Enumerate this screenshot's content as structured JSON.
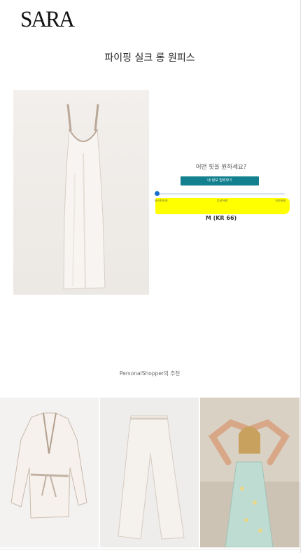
{
  "brand": {
    "logo_text": "SARA"
  },
  "product": {
    "title": "파이핑 실크 롱 원피스",
    "image_description_icon": "dress-product-image"
  },
  "fit": {
    "question": "어떤 핏을 원하세요?",
    "button_label": "내 정보 입력하기",
    "slider_value": 0,
    "slider_labels": [
      "타이트하게",
      "무난하게",
      "넉넉하게"
    ],
    "size_result": "M (KR 66)"
  },
  "recommend": {
    "heading": "PersonalShopper의 추천",
    "items": [
      {
        "icon": "jacket-product-image"
      },
      {
        "icon": "pants-product-image"
      },
      {
        "icon": "model-dress-image"
      }
    ]
  },
  "colors": {
    "accent": "#12808e",
    "slider": "#1a6fd1",
    "highlight": "#ffff00"
  }
}
